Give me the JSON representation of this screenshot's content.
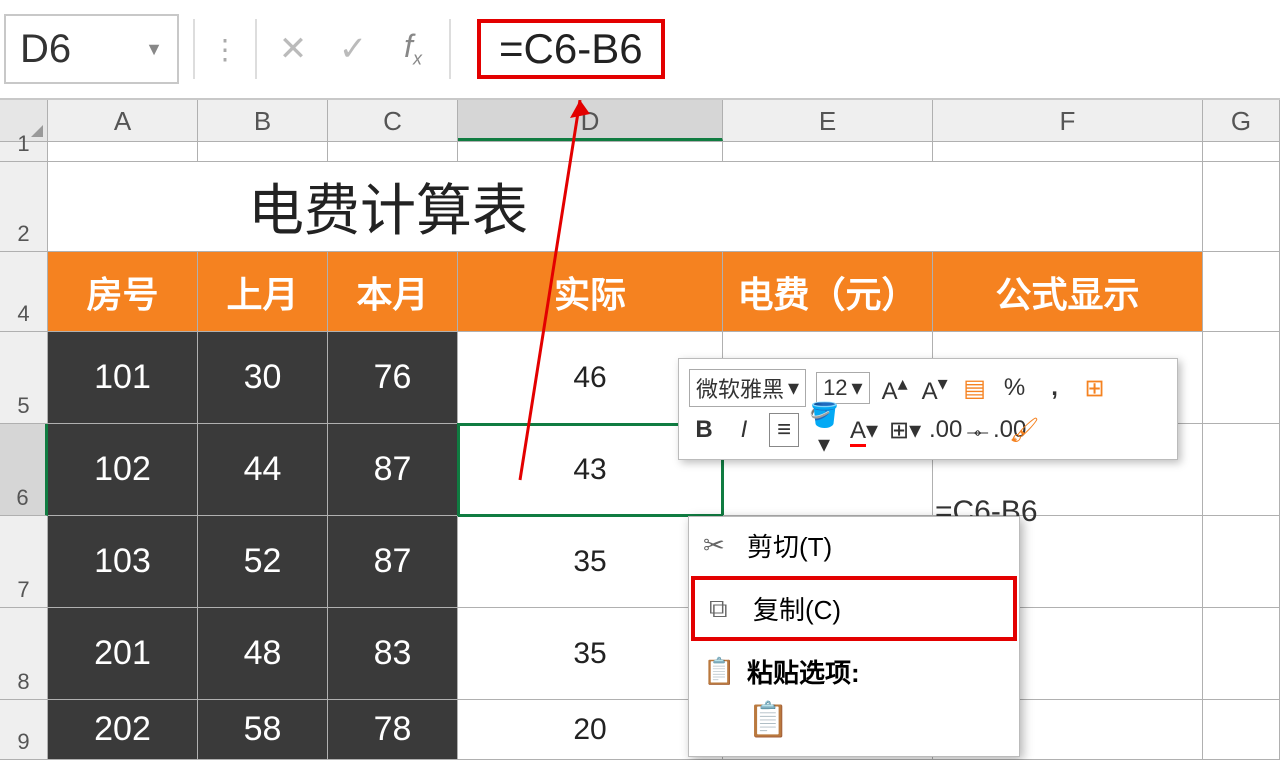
{
  "nameBox": "D6",
  "formula": "=C6-B6",
  "columns": [
    "A",
    "B",
    "C",
    "D",
    "E",
    "F",
    "G"
  ],
  "rowNums": [
    "1",
    "2",
    "4",
    "5",
    "6",
    "7",
    "8",
    "9"
  ],
  "title": "电费计算表",
  "headers": {
    "A": "房号",
    "B": "上月",
    "C": "本月",
    "D": "实际",
    "E": "电费（元）",
    "F": "公式显示"
  },
  "rows": [
    {
      "A": "101",
      "B": "30",
      "C": "76",
      "D": "46"
    },
    {
      "A": "102",
      "B": "44",
      "C": "87",
      "D": "43"
    },
    {
      "A": "103",
      "B": "52",
      "C": "87",
      "D": "35"
    },
    {
      "A": "201",
      "B": "48",
      "C": "83",
      "D": "35"
    },
    {
      "A": "202",
      "B": "58",
      "C": "78",
      "D": "20"
    }
  ],
  "f6": "=C6-B6",
  "miniToolbar": {
    "font": "微软雅黑",
    "size": "12"
  },
  "contextMenu": {
    "cut": "剪切(T)",
    "copy": "复制(C)",
    "pasteOptions": "粘贴选项:"
  }
}
